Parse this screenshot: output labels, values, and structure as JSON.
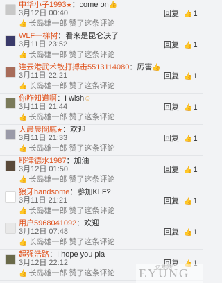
{
  "comments": [
    {
      "name": "中华小子1993",
      "text": "：come on",
      "emoji": "👍",
      "vip": "★",
      "time": "3月12日 00:40",
      "liked_by": "长岛雄一郎 赞了这条评论",
      "reply": "回复",
      "likes": "1",
      "avatar_color": "#c8c8c8"
    },
    {
      "name": "WLF一梯树",
      "text": "：看来是昆仑决了",
      "emoji": "",
      "vip": "",
      "time": "3月11日 23:52",
      "liked_by": "长岛雄一郎 赞了这条评论",
      "reply": "回复",
      "likes": "1",
      "avatar_color": "#3a3a6a"
    },
    {
      "name": "连云港武术散打搏击5513114080",
      "text": "：厉害",
      "emoji": "👍",
      "vip": "",
      "time": "3月11日 22:21",
      "liked_by": "长岛雄一郎 赞了这条评论",
      "reply": "回复",
      "likes": "1",
      "avatar_color": "#a86c5a"
    },
    {
      "name": "你咋知道啊",
      "text": "：I wish",
      "emoji": "☺",
      "vip": "",
      "time": "3月11日 21:44",
      "liked_by": "长岛雄一郎 赞了这条评论",
      "reply": "回复",
      "likes": "1",
      "avatar_color": "#7a7a5a"
    },
    {
      "name": "大晨晨冏腻",
      "text": "：欢迎",
      "emoji": "",
      "vip": "★",
      "time": "3月11日 21:33",
      "liked_by": "长岛雄一郎 赞了这条评论",
      "reply": "回复",
      "likes": "1",
      "avatar_color": "#9a9aa8"
    },
    {
      "name": "耶律德水1987",
      "text": "：加油",
      "emoji": "",
      "vip": "",
      "time": "3月12日 01:50",
      "liked_by": "长岛雄一郎 赞了这条评论",
      "reply": "回复",
      "likes": "1",
      "avatar_color": "#5a4a3a"
    },
    {
      "name": "狼牙handsome",
      "text": "：参加KLF?",
      "emoji": "",
      "vip": "",
      "time": "3月11日 21:21",
      "liked_by": "长岛雄一郎 赞了这条评论",
      "reply": "回复",
      "likes": "1",
      "avatar_color": "#ffffff"
    },
    {
      "name": "用户5968041092",
      "text": "：欢迎",
      "emoji": "",
      "vip": "",
      "time": "3月12日 07:48",
      "liked_by": "长岛雄一郎 赞了这条评论",
      "reply": "回复",
      "likes": "1",
      "avatar_color": "#e8e8e8"
    },
    {
      "name": "超强浩路",
      "text": "：I hope you pla",
      "emoji": "",
      "vip": "",
      "time": "3月12日 22:12",
      "liked_by": "长岛雄一郎 赞了这条评论",
      "reply": "回复",
      "likes": "1",
      "avatar_color": "#6a6a4a"
    }
  ],
  "watermark": {
    "logo": "EYUNG",
    "cn": "亿友网"
  }
}
